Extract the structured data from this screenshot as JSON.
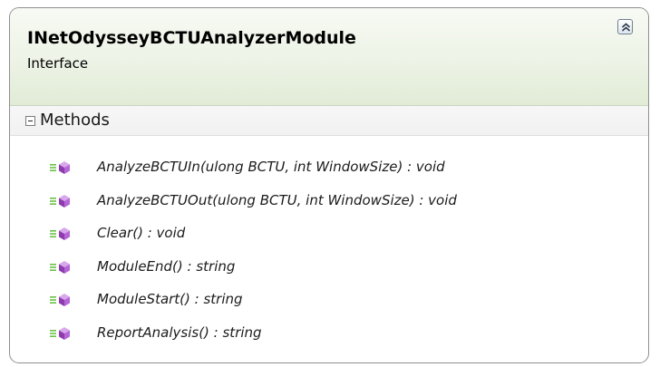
{
  "class_shape": {
    "name": "INetOdysseyBCTUAnalyzerModule",
    "stereotype": "Interface",
    "collapse_icon": "double-chevron-up-icon"
  },
  "methods_section": {
    "label": "Methods",
    "toggle_icon": "minus-box-icon",
    "item_icon": "public-method-icon",
    "items": [
      {
        "signature": "AnalyzeBCTUIn(ulong BCTU, int WindowSize) : void"
      },
      {
        "signature": "AnalyzeBCTUOut(ulong BCTU, int WindowSize) : void"
      },
      {
        "signature": "Clear() : void"
      },
      {
        "signature": "ModuleEnd() : string"
      },
      {
        "signature": "ModuleStart() : string"
      },
      {
        "signature": "ReportAnalysis() : string"
      }
    ]
  },
  "colors": {
    "header_fill": "#e8f0df",
    "border": "#8f8f8f",
    "method_icon_purple": "#a24fc1",
    "method_icon_green": "#6cc04a"
  }
}
